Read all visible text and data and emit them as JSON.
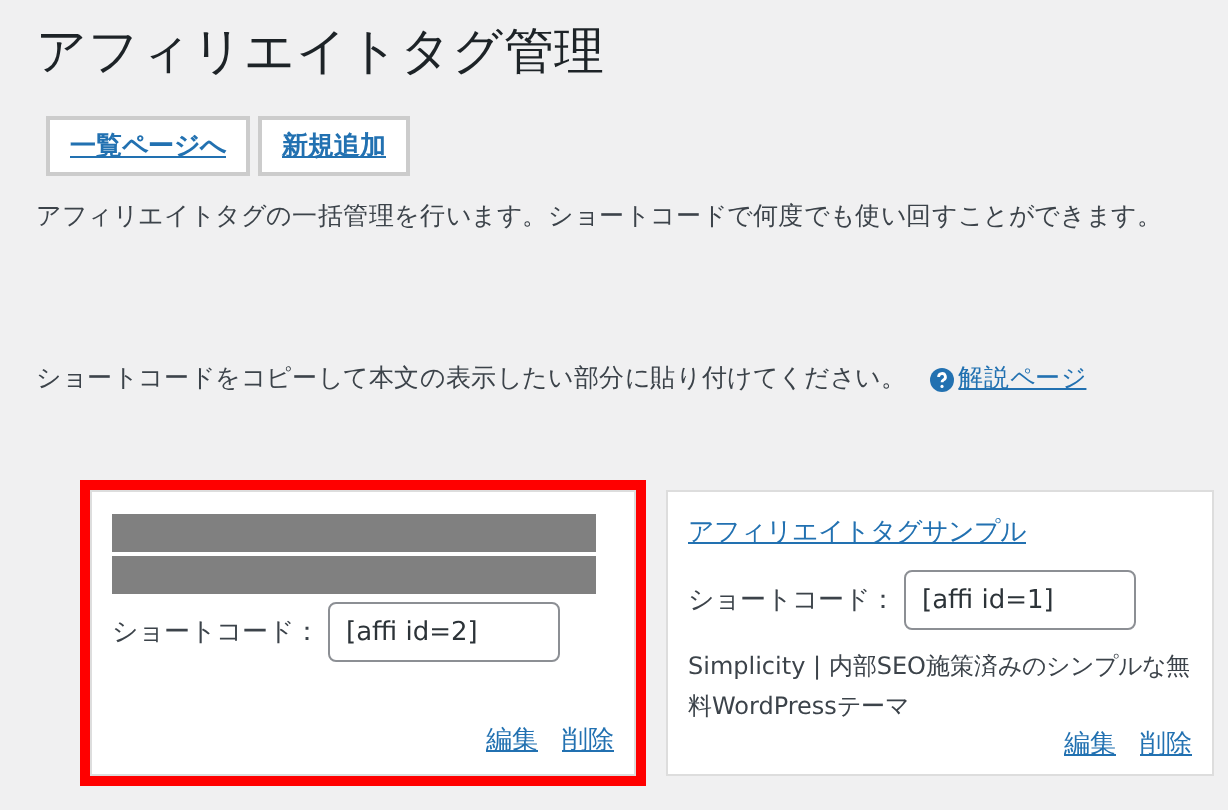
{
  "page_title": "アフィリエイトタグ管理",
  "buttons": [
    {
      "label": "一覧ページへ"
    },
    {
      "label": "新規追加"
    }
  ],
  "description": "アフィリエイトタグの一括管理を行います。ショートコードで何度でも使い回すことができます。",
  "instruction": {
    "text": "ショートコードをコピーして本文の表示したい部分に貼り付けてください。",
    "help_link": "解説ページ"
  },
  "cards": [
    {
      "highlighted": true,
      "redacted": true,
      "shortcode_label": "ショートコード：",
      "shortcode": "[affi id=2]",
      "actions": [
        "編集",
        "削除"
      ]
    },
    {
      "highlighted": false,
      "redacted": false,
      "title": "アフィリエイトタグサンプル",
      "shortcode_label": "ショートコード：",
      "shortcode": "[affi id=1]",
      "text": "Simplicity | 内部SEO施策済みのシンプルな無料WordPressテーマ",
      "actions": [
        "編集",
        "削除"
      ]
    }
  ]
}
